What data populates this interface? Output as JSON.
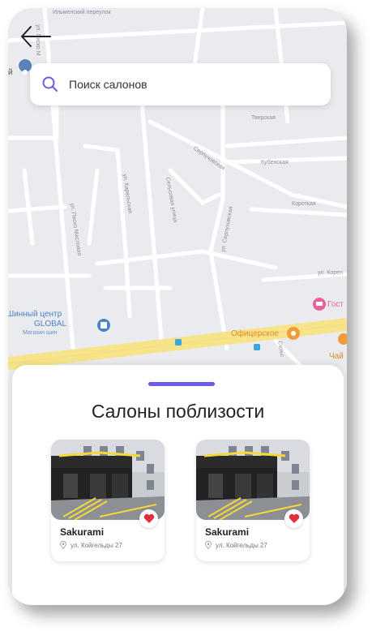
{
  "search": {
    "placeholder": "Поиск салонов"
  },
  "map": {
    "streets": {
      "ilmensky": "Ильменский переулок",
      "tverskaya": "Тверская",
      "kubenskaya": "Кубенская",
      "serpukhovskaya_diag": "Серпуховская",
      "korotkaya": "Короткая",
      "korenovskaya": "ул. Корен",
      "pisko": "ул. Писко М",
      "pisko2": "ул. Писко Масловая",
      "karelskaya": "ул. Карельская",
      "selskaya": "Сельсовая улица",
      "serpukhovskaya": "ул. Серпуховская",
      "selsk2": "Сельс"
    },
    "pois": {
      "shinny_line1": "Шинный центр",
      "shinny_line2": "GLOBAL",
      "shinny_sub": "Магазин шин",
      "ofitserskoe": "Офицерское",
      "gost": "Гост",
      "chay": "Чай",
      "left_partial": "й"
    }
  },
  "sheet": {
    "title": "Салоны поблизости",
    "cards": [
      {
        "name": "Sakurami",
        "address": "ул. Койгельды 27"
      },
      {
        "name": "Sakurami",
        "address": "ул. Койгельды 27"
      }
    ]
  },
  "colors": {
    "accent": "#6b5ce6",
    "heart": "#e0303b",
    "road_major": "#f7e48a"
  }
}
